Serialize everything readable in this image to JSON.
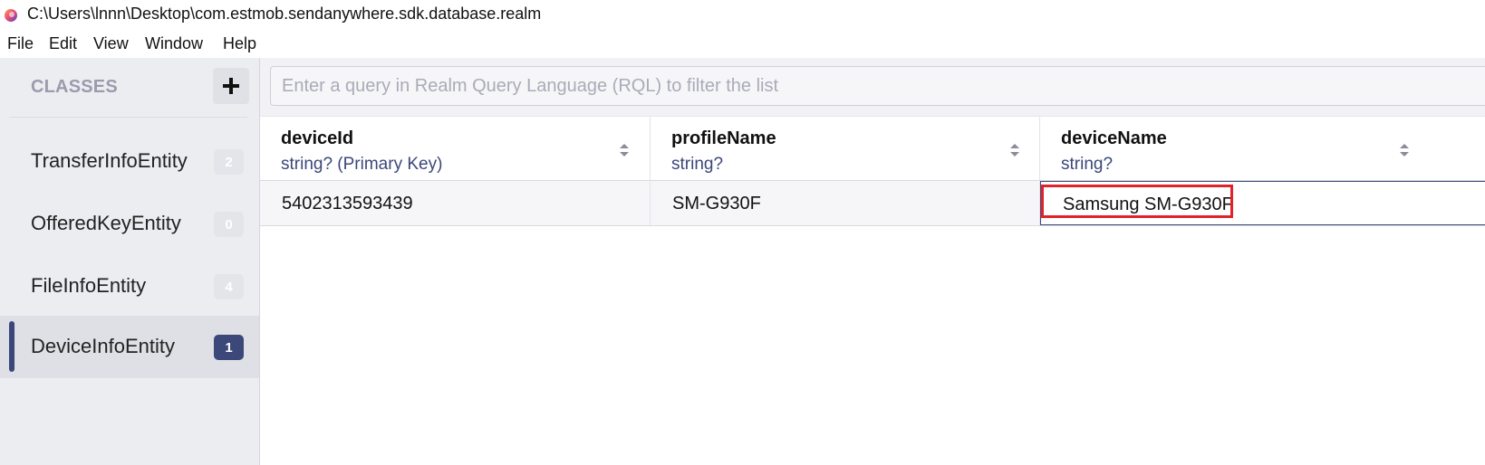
{
  "window": {
    "title": "C:\\Users\\lnnn\\Desktop\\com.estmob.sendanywhere.sdk.database.realm"
  },
  "menu": {
    "items": [
      "File",
      "Edit",
      "View",
      "Window",
      "Help"
    ]
  },
  "sidebar": {
    "header": "CLASSES",
    "add_icon": "plus-icon",
    "items": [
      {
        "label": "TransferInfoEntity",
        "count": "2",
        "selected": false
      },
      {
        "label": "OfferedKeyEntity",
        "count": "0",
        "selected": false
      },
      {
        "label": "FileInfoEntity",
        "count": "4",
        "selected": false
      },
      {
        "label": "DeviceInfoEntity",
        "count": "1",
        "selected": true
      }
    ]
  },
  "query": {
    "placeholder": "Enter a query in Realm Query Language (RQL) to filter the list",
    "value": ""
  },
  "table": {
    "columns": [
      {
        "name": "deviceId",
        "type": "string? (Primary Key)"
      },
      {
        "name": "profileName",
        "type": "string?"
      },
      {
        "name": "deviceName",
        "type": "string?"
      }
    ],
    "rows": [
      [
        "5402313593439",
        "SM-G930F",
        "Samsung SM-G930F"
      ]
    ]
  },
  "colors": {
    "accent": "#3b4879",
    "highlight": "#e0222a",
    "sidebar_bg": "#ecedf1"
  }
}
